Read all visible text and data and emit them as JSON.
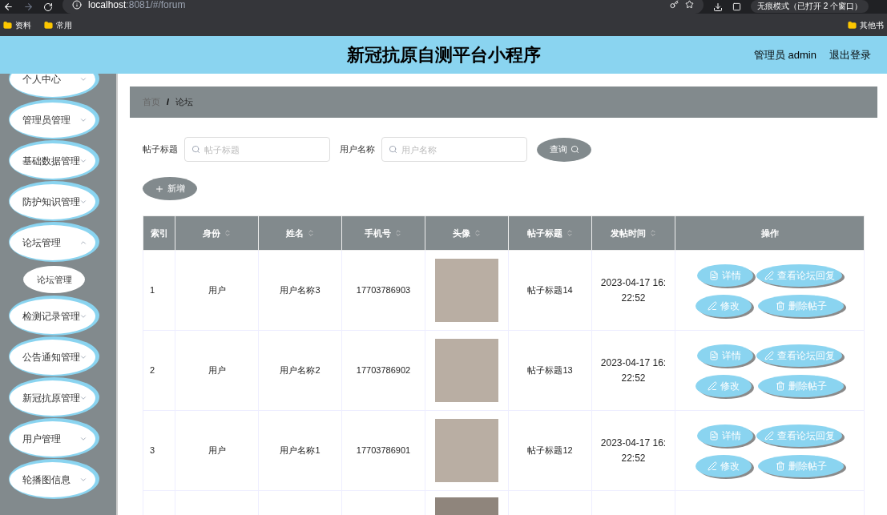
{
  "browser": {
    "url_host": "localhost",
    "url_rest": ":8081/#/forum",
    "profile": "无痕模式（已打开 2 个窗口）",
    "bookmarks": [
      "资料",
      "常用"
    ],
    "other_bookmarks": "其他书"
  },
  "header": {
    "title": "新冠抗原自测平台小程序",
    "user": "管理员 admin",
    "logout": "退出登录"
  },
  "sidebar": {
    "items": [
      {
        "label": "个人中心",
        "expanded": false
      },
      {
        "label": "管理员管理",
        "expanded": false
      },
      {
        "label": "基础数据管理",
        "expanded": false
      },
      {
        "label": "防护知识管理",
        "expanded": false
      },
      {
        "label": "论坛管理",
        "expanded": true,
        "children": [
          {
            "label": "论坛管理"
          }
        ]
      },
      {
        "label": "检测记录管理",
        "expanded": false
      },
      {
        "label": "公告通知管理",
        "expanded": false
      },
      {
        "label": "新冠抗原管理",
        "expanded": false
      },
      {
        "label": "用户管理",
        "expanded": false
      },
      {
        "label": "轮播图信息",
        "expanded": false
      }
    ]
  },
  "breadcrumb": [
    {
      "label": "首页",
      "current": false
    },
    {
      "label": "论坛",
      "current": true
    }
  ],
  "breadcrumb_separator": "/",
  "search": {
    "fields": [
      {
        "label": "帖子标题",
        "placeholder": "帖子标题"
      },
      {
        "label": "用户名称",
        "placeholder": "用户名称"
      }
    ],
    "button": "查询"
  },
  "add_button": "新增",
  "table": {
    "columns": [
      {
        "label": "索引",
        "sortable": false
      },
      {
        "label": "身份",
        "sortable": true
      },
      {
        "label": "姓名",
        "sortable": true
      },
      {
        "label": "手机号",
        "sortable": true
      },
      {
        "label": "头像",
        "sortable": true
      },
      {
        "label": "帖子标题",
        "sortable": true
      },
      {
        "label": "发帖时间",
        "sortable": true
      },
      {
        "label": "操作",
        "sortable": false
      }
    ],
    "rows": [
      {
        "index": "1",
        "role": "用户",
        "name": "用户名称3",
        "phone": "17703786903",
        "title": "帖子标题14",
        "time": "2023-04-17 16:22:52",
        "actions": [
          "详情",
          "查看论坛回复",
          "修改",
          "删除帖子"
        ]
      },
      {
        "index": "2",
        "role": "用户",
        "name": "用户名称2",
        "phone": "17703786902",
        "title": "帖子标题13",
        "time": "2023-04-17 16:22:52",
        "actions": [
          "详情",
          "查看论坛回复",
          "修改",
          "删除帖子"
        ]
      },
      {
        "index": "3",
        "role": "用户",
        "name": "用户名称1",
        "phone": "17703786901",
        "title": "帖子标题12",
        "time": "2023-04-17 16:22:52",
        "actions": [
          "详情",
          "查看论坛回复",
          "修改",
          "删除帖子"
        ]
      }
    ]
  }
}
